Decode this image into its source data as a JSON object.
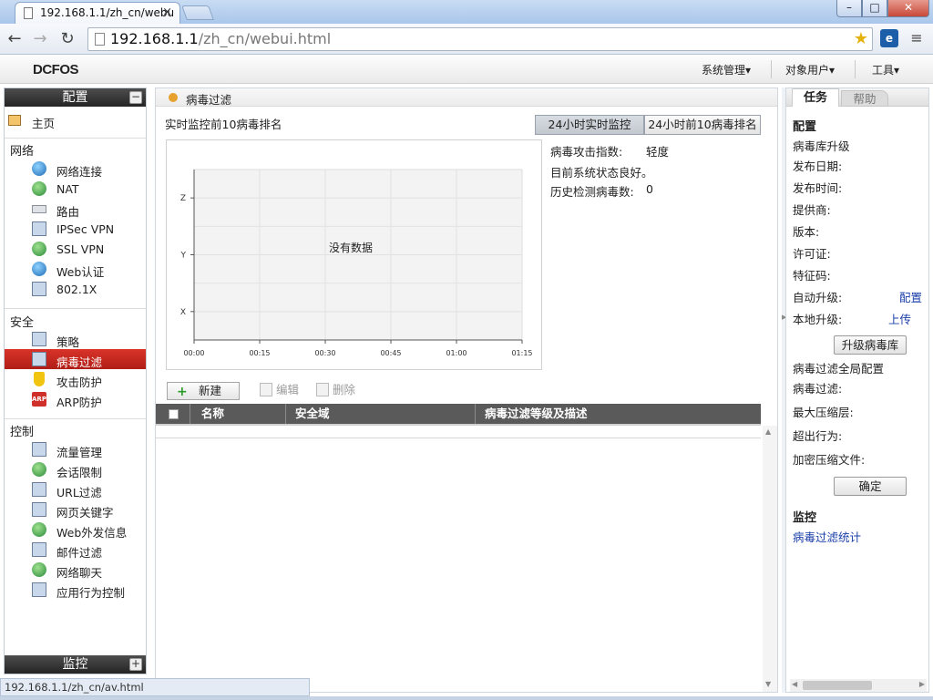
{
  "browser": {
    "tab_title": "192.168.1.1/zh_cn/webu",
    "tab_close": "×",
    "url_host": "192.168.1.1",
    "url_path": "/zh_cn/webui.html",
    "window_controls": {
      "minimize": "–",
      "maximize": "□",
      "close": "✕"
    },
    "status_url": "192.168.1.1/zh_cn/av.html"
  },
  "header": {
    "logo": "DCFOS",
    "menus": [
      "系统管理▾",
      "对象用户▾",
      "工具▾"
    ]
  },
  "sidebar": {
    "config_title": "配置",
    "collapse": "−",
    "home": "主页",
    "groups": [
      {
        "title": "网络",
        "items": [
          "网络连接",
          "NAT",
          "路由",
          "IPSec VPN",
          "SSL VPN",
          "Web认证",
          "802.1X"
        ]
      },
      {
        "title": "安全",
        "items": [
          "策略",
          "病毒过滤",
          "攻击防护",
          "ARP防护"
        ]
      },
      {
        "title": "控制",
        "items": [
          "流量管理",
          "会话限制",
          "URL过滤",
          "网页关键字",
          "Web外发信息",
          "邮件过滤",
          "网络聊天",
          "应用行为控制"
        ]
      }
    ],
    "active_item": "病毒过滤",
    "monitor_title": "监控",
    "expand": "+",
    "arp_badge": "ARP"
  },
  "main": {
    "breadcrumb": "病毒过滤",
    "section_title": "实时监控前10病毒排名",
    "tabs": [
      "24小时实时监控",
      "24小时前10病毒排名"
    ],
    "stats": {
      "attack_index_label": "病毒攻击指数:",
      "attack_index_value": "轻度",
      "status_text": "目前系统状态良好。",
      "history_label": "历史检测病毒数:",
      "history_value": "0"
    },
    "actions": {
      "new": "新建",
      "edit": "编辑",
      "delete": "删除"
    },
    "table_headers": [
      "名称",
      "安全域",
      "病毒过滤等级及描述"
    ]
  },
  "chart_data": {
    "type": "line",
    "x": [
      "00:00",
      "00:15",
      "00:30",
      "00:45",
      "01:00",
      "01:15"
    ],
    "y_categories": [
      "X",
      "Y",
      "Z"
    ],
    "series": [],
    "annotation": "没有数据",
    "grid": true
  },
  "right_panel": {
    "tabs": [
      "任务",
      "帮助"
    ],
    "config_heading": "配置",
    "db_upgrade": "病毒库升级",
    "fields": [
      "发布日期:",
      "发布时间:",
      "提供商:",
      "版本:",
      "许可证:",
      "特征码:"
    ],
    "auto_upgrade": "自动升级:",
    "auto_upgrade_link": "配置",
    "local_upgrade": "本地升级:",
    "local_upgrade_link": "上传",
    "upgrade_button": "升级病毒库",
    "global_config": "病毒过滤全局配置",
    "global_fields": [
      "病毒过滤:",
      "最大压缩层:",
      "超出行为:",
      "加密压缩文件:"
    ],
    "confirm_button": "确定",
    "monitor_heading": "监控",
    "monitor_link": "病毒过滤统计"
  }
}
